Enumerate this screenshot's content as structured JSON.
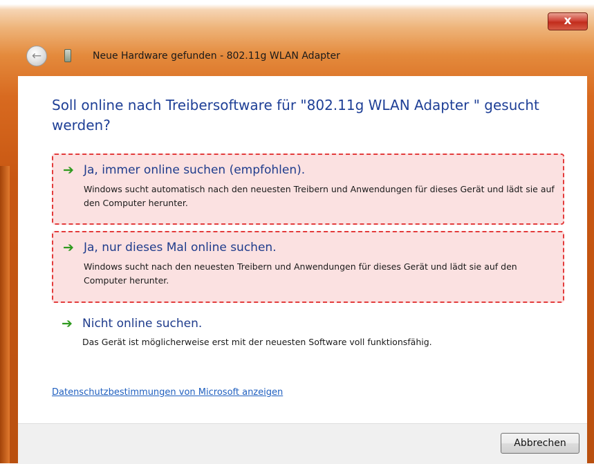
{
  "window": {
    "title": "Neue Hardware gefunden - 802.11g WLAN Adapter",
    "close_symbol": "x",
    "back_symbol": "←"
  },
  "heading": "Soll online nach Treibersoftware für \"802.11g WLAN Adapter    \" gesucht werden?",
  "options": [
    {
      "title": "Ja, immer online suchen (empfohlen).",
      "description": "Windows sucht automatisch nach den neuesten Treibern und Anwendungen für dieses Gerät und lädt sie auf den Computer herunter.",
      "icon": "green-arrow-icon",
      "highlighted": true
    },
    {
      "title": "Ja, nur dieses Mal online suchen.",
      "description": "Windows sucht nach den neuesten Treibern und Anwendungen für dieses Gerät und lädt sie auf den Computer herunter.",
      "icon": "green-arrow-icon",
      "highlighted": true
    },
    {
      "title": "Nicht online suchen.",
      "description": "Das Gerät ist möglicherweise erst mit der neuesten Software voll funktionsfähig.",
      "icon": "green-arrow-icon",
      "highlighted": false
    }
  ],
  "arrow_glyph": "➔",
  "privacy_link": "Datenschutzbestimmungen von Microsoft anzeigen",
  "footer": {
    "cancel_label": "Abbrechen"
  },
  "colors": {
    "frame_accent": "#d86a20",
    "heading_text": "#1e3f96",
    "highlight_border": "#e33b3b",
    "highlight_fill": "#fbe1e1",
    "arrow": "#2f9a1f"
  }
}
